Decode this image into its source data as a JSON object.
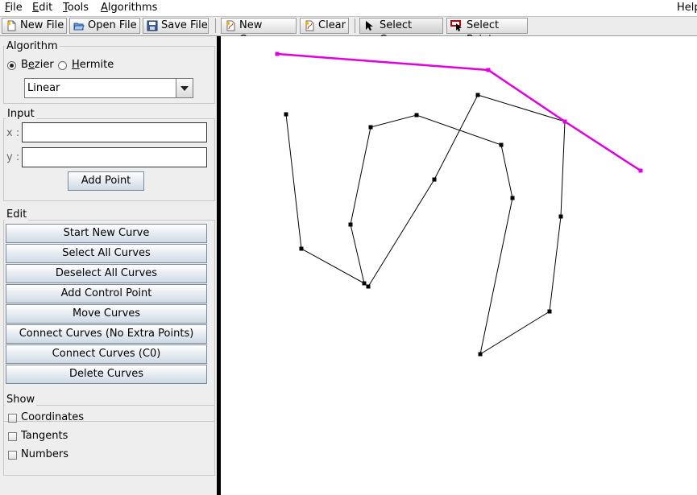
{
  "menubar": {
    "file": {
      "mnemonic": "F",
      "rest": "ile"
    },
    "edit": {
      "mnemonic": "E",
      "rest": "dit"
    },
    "tools": {
      "mnemonic": "T",
      "rest": "ools"
    },
    "algorithms": {
      "mnemonic": "A",
      "rest": "lgorithms"
    },
    "help": "Help"
  },
  "toolbar": {
    "new_file": "New File",
    "open_file": "Open File",
    "save_file": "Save File",
    "new_curve": "New Curve",
    "clear": "Clear",
    "select_curve": "Select Curve",
    "select_point": "Select Point"
  },
  "algorithm": {
    "title": "Algorithm",
    "bezier_pre": "B",
    "bezier_mn": "e",
    "bezier_post": "zier",
    "hermite_pre": "",
    "hermite_mn": "H",
    "hermite_post": "ermite",
    "selected": "Bezier",
    "mode": "Linear"
  },
  "input": {
    "title": "Input",
    "x_label": "x :",
    "y_label": "y :",
    "x_value": "",
    "y_value": "",
    "add_point": "Add Point"
  },
  "edit": {
    "title": "Edit",
    "buttons": [
      "Start New Curve",
      "Select All Curves",
      "Deselect All Curves",
      "Add Control Point",
      "Move Curves",
      "Connect Curves (No Extra Points)",
      "Connect Curves (C0)",
      "Delete Curves"
    ]
  },
  "show": {
    "title": "Show",
    "coordinates": "Coordinates",
    "tangents": "Tangents",
    "numbers": "Numbers",
    "coordinates_checked": false,
    "tangents_checked": false,
    "numbers_checked": false
  },
  "colors": {
    "selected_curve": "#e000e0",
    "curve": "#000000"
  },
  "curves": {
    "black": [
      [
        81,
        97
      ],
      [
        100,
        264
      ],
      [
        178,
        307
      ],
      [
        161,
        234
      ],
      [
        186,
        113
      ],
      [
        243,
        98
      ],
      [
        348,
        135
      ],
      [
        362,
        201
      ],
      [
        322,
        395
      ],
      [
        408,
        342
      ],
      [
        422,
        224
      ],
      [
        427,
        106
      ],
      [
        319,
        73
      ],
      [
        265,
        178
      ],
      [
        183,
        311
      ]
    ],
    "magenta": [
      [
        70,
        22
      ],
      [
        332,
        42
      ],
      [
        427,
        106
      ],
      [
        521,
        167
      ]
    ]
  }
}
